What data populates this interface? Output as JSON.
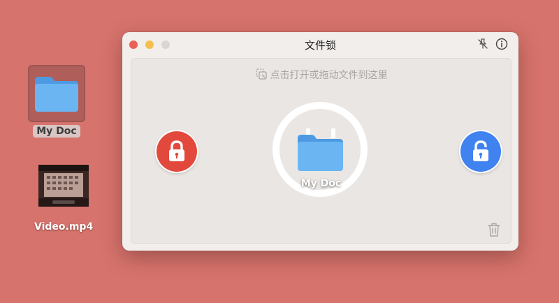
{
  "desktop": {
    "folder": {
      "label": "My Doc",
      "icon": "folder-icon"
    },
    "video": {
      "label": "Video.mp4",
      "icon": "video-thumbnail"
    }
  },
  "window": {
    "title": "文件锁",
    "hint": "点击打开或拖动文件到这里",
    "center_item": {
      "label": "My Doc",
      "icon": "folder-icon"
    },
    "left_action_icon": "lock-icon",
    "right_action_icon": "unlock-icon",
    "titlebar_icons": [
      "pin-off-icon",
      "info-icon"
    ],
    "trash_icon": "trash-icon"
  },
  "colors": {
    "desktop_bg": "#d6736c",
    "lock_red": "#e2493c",
    "unlock_blue": "#3f82f0",
    "folder_blue": "#5aa7e8"
  }
}
